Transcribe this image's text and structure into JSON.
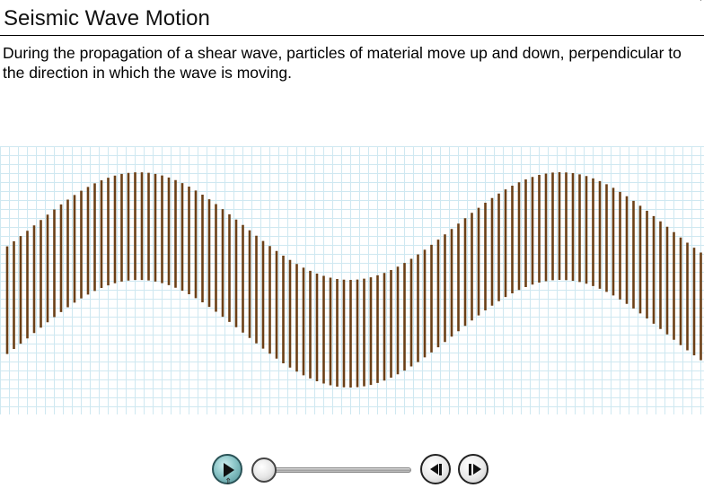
{
  "header": {
    "title": "Seismic Wave Motion"
  },
  "main": {
    "description": "During the propagation of a shear wave, particles of material move up and down, perpendicular to the direction in which the wave is moving."
  },
  "animation": {
    "particle_color": "#6b3f16",
    "grid_color": "#cfe8f1"
  },
  "controls": {
    "play_icon": "play-icon",
    "step_back_icon": "step-back-icon",
    "step_forward_icon": "step-forward-icon",
    "progress": 0
  }
}
